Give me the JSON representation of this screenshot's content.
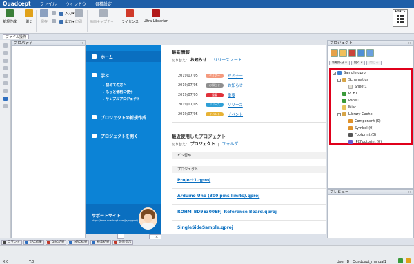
{
  "app": {
    "logo": "Quadcept",
    "menus": [
      "ファイル",
      "ウィンドウ",
      "各種設定"
    ]
  },
  "ribbon": {
    "buttons": [
      {
        "label": "新規作成",
        "color": "#3a7f3a",
        "disabled": false
      },
      {
        "label": "開く",
        "color": "#e0a11a",
        "disabled": false
      },
      {
        "label": "保存",
        "color": "#8aa0c0",
        "disabled": true
      },
      {
        "label": "印刷",
        "color": "#a8b0bc",
        "disabled": true
      },
      {
        "label": "画面キャプチャー",
        "color": "#a8b0bc",
        "disabled": true
      },
      {
        "label": "ライセンス",
        "color": "#d03a2a",
        "disabled": false
      },
      {
        "label": "Ultra Librarian",
        "color": "#b21a1a",
        "disabled": false
      }
    ],
    "small": {
      "copy": "",
      "paste": "",
      "input": "入力",
      "output": "出力"
    },
    "force_label": "FORCE"
  },
  "file_op_tab": "ファイル操作",
  "panels": {
    "property": "プロパティ",
    "project": "プロジェクト",
    "preview": "プレビュー"
  },
  "start": {
    "nav": {
      "home": "ホーム",
      "learn": "学ぶ",
      "learn_subs": [
        "初めての方へ",
        "もっと便利に使う",
        "サンプルプロジェクト"
      ],
      "new_project": "プロジェクトの新規作成",
      "open_project": "プロジェクトを開く"
    },
    "support": {
      "title": "サポートサイト",
      "url": "https://www.quadcept.com/ja/support/"
    },
    "news": {
      "title": "最新情報",
      "switch_label": "切り替え：",
      "current": "お知らせ",
      "sep": "|",
      "alt": "リリースノート",
      "rows": [
        {
          "date": "2019/07/05",
          "badge": "セミナー",
          "color": "#f49a7e",
          "link": "セミナー"
        },
        {
          "date": "2019/07/05",
          "badge": "お知らせ",
          "color": "#8e8e8e",
          "link": "お知らせ"
        },
        {
          "date": "2019/07/05",
          "badge": "重要",
          "color": "#e0313a",
          "link": "重要"
        },
        {
          "date": "2019/07/05",
          "badge": "リリース",
          "color": "#2e9fd6",
          "link": "リリース"
        },
        {
          "date": "2019/07/05",
          "badge": "イベント",
          "color": "#e7b235",
          "link": "イベント"
        }
      ]
    },
    "recent": {
      "title": "最近使用したプロジェクト",
      "switch_label": "切り替え：",
      "current": "プロジェクト",
      "sep": "|",
      "alt": "フォルダ",
      "pinned": "ピン留め",
      "header": "プロジェクト",
      "items": [
        "Project1.qproj",
        "Arduino Uno (300 pins limits).qproj",
        "ROHM_BD9E300EFJ_Reference Board.qproj",
        "SingleSideSample.qproj"
      ]
    },
    "tab_label": "スタートページ",
    "tab_close": "×"
  },
  "project_tree": {
    "buttons": [
      "新規作成 ▾",
      "開く ▾",
      "閉じる"
    ],
    "nodes": [
      {
        "label": "Sample.qproj",
        "color": "#3c7fd0",
        "exp": "-"
      },
      {
        "label": "Schematics",
        "color": "#d7a548",
        "exp": "-"
      },
      {
        "label": "Sheet1",
        "color": "#e8e4d8",
        "exp": ""
      },
      {
        "label": "PCB1",
        "color": "#3a9a3a",
        "exp": ""
      },
      {
        "label": "Panel1",
        "color": "#3a9a3a",
        "exp": ""
      },
      {
        "label": "Misc",
        "color": "#e6c35a",
        "exp": ""
      },
      {
        "label": "Library Cache",
        "color": "#d7a548",
        "exp": "-"
      },
      {
        "label": "Component (0)",
        "color": "#e0922a",
        "exp": ""
      },
      {
        "label": "Symbol (0)",
        "color": "#e0922a",
        "exp": ""
      },
      {
        "label": "Footprint (0)",
        "color": "#555555",
        "exp": ""
      },
      {
        "label": "IPCFootprint (0)",
        "color": "#6a5acd",
        "exp": ""
      }
    ]
  },
  "bottom_tabs": [
    {
      "label": "コマンド",
      "color": "#444"
    },
    {
      "label": "ERC結果",
      "color": "#2e6fc0"
    },
    {
      "label": "DRC結果",
      "color": "#c0392b"
    },
    {
      "label": "MRC結果",
      "color": "#2e6fc0"
    },
    {
      "label": "検索結果",
      "color": "#2e6fc0"
    },
    {
      "label": "設計指示",
      "color": "#c0392b"
    }
  ],
  "status": {
    "x": "X:0",
    "y": "Y:0",
    "user": "User ID : Quadcept_manual1"
  },
  "colors": {
    "accent": "#0c83d6",
    "title_bar": "#1f5fa8",
    "highlight": "#e0001b"
  }
}
